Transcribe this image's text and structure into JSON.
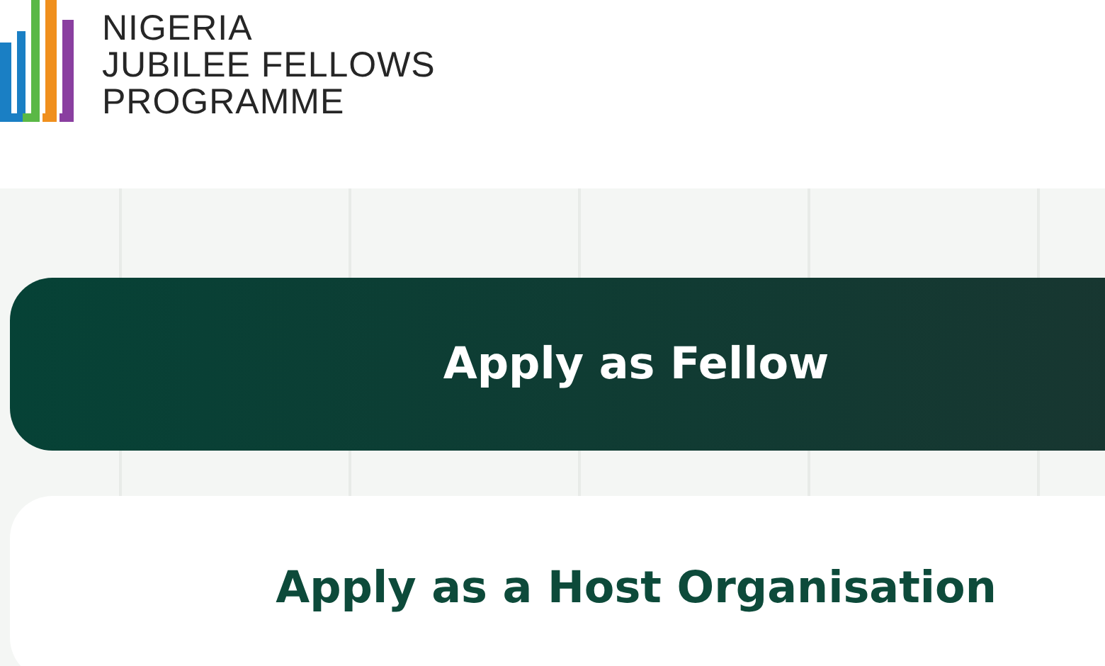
{
  "logo": {
    "lines": [
      "NIGERIA",
      "JUBILEE FELLOWS",
      "PROGRAMME"
    ]
  },
  "actions": [
    {
      "label": "Apply as Fellow",
      "kind": "primary"
    },
    {
      "label": "Apply as a Host Organisation",
      "kind": "secondary"
    }
  ]
}
